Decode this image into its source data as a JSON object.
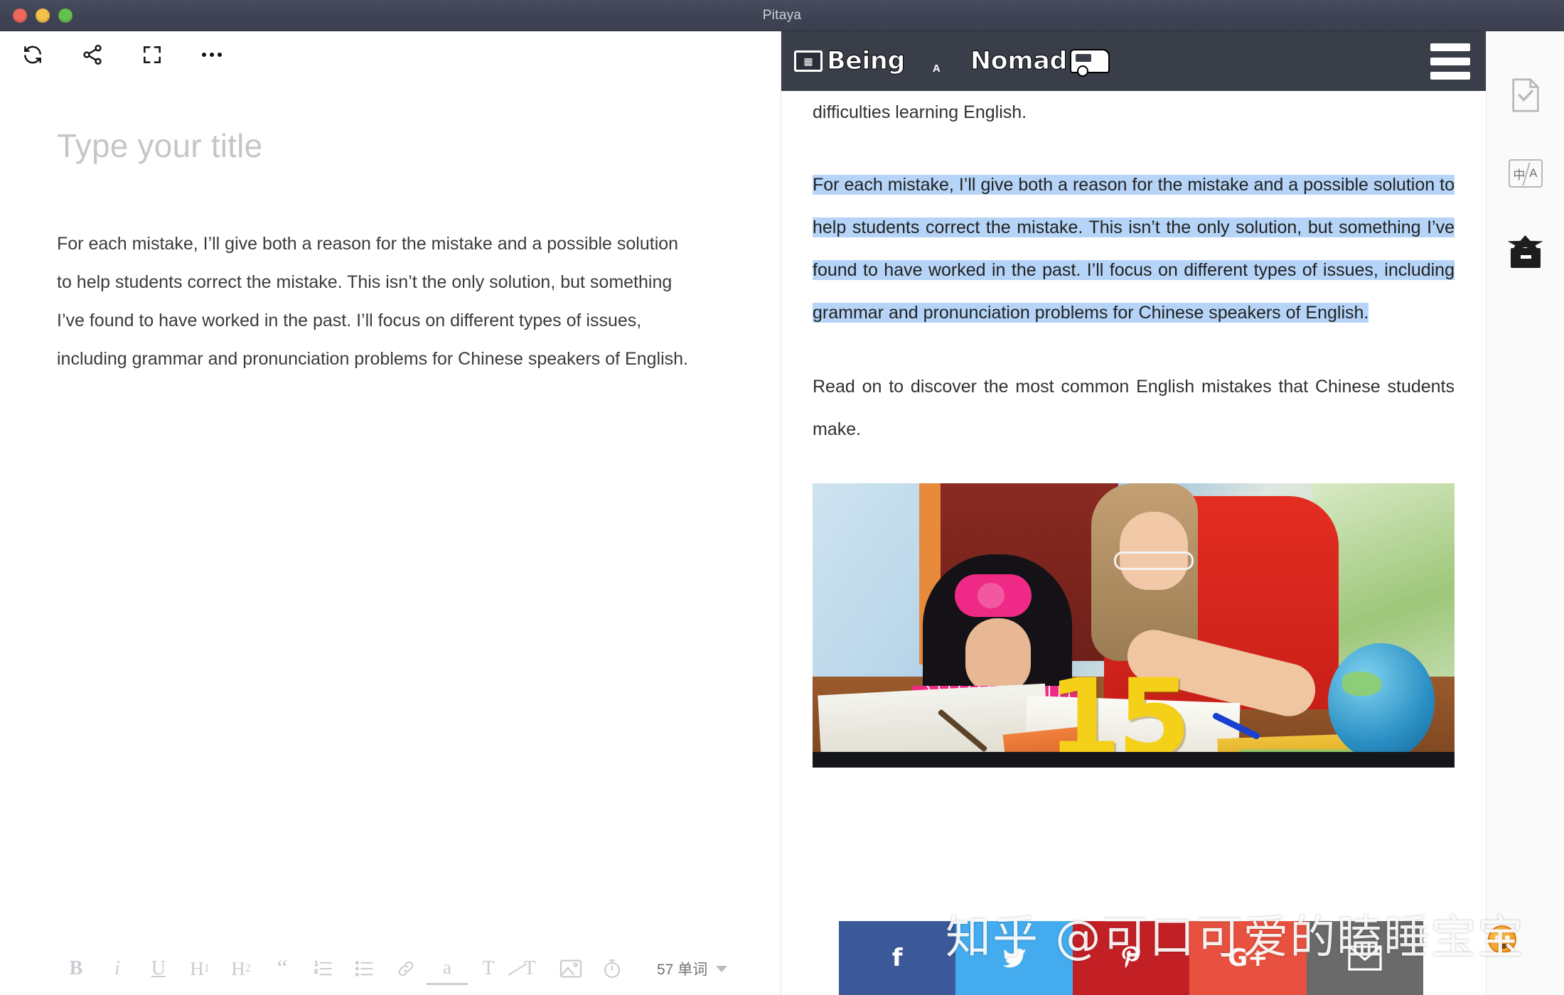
{
  "window": {
    "title": "Pitaya",
    "traffic_lights": [
      "close",
      "minimize",
      "zoom"
    ]
  },
  "editor": {
    "toolbar": [
      {
        "name": "refresh-icon",
        "label": "Sync"
      },
      {
        "name": "share-icon",
        "label": "Share"
      },
      {
        "name": "fullscreen-icon",
        "label": "Fullscreen"
      },
      {
        "name": "more-icon",
        "label": "More"
      }
    ],
    "title_placeholder": "Type your title",
    "title_value": "",
    "body_text": "For each mistake, I’ll give both a reason for the mistake and a possible solution to help students correct the mistake. This isn’t the only solution, but something I’ve found to have worked in the past. I’ll focus on different types of issues, including grammar and pronunciation problems for Chinese speakers of English.",
    "format_bar": {
      "bold": "B",
      "italic": "i",
      "underline": "U",
      "heading1": "H",
      "heading1_sub": "1",
      "heading2": "H",
      "heading2_sub": "2",
      "blockquote": "“",
      "ordered_list": "ordered-list-icon",
      "unordered_list": "unordered-list-icon",
      "link": "link-icon",
      "highlight": "a",
      "text_style": "T",
      "clear_format": "T",
      "image": "image-icon",
      "timer": "timer-icon",
      "word_count": "57 单词"
    }
  },
  "preview": {
    "site_banner": {
      "logo_text_1": "Being",
      "logo_letter": "A",
      "logo_text_2": "Nomad",
      "menu": "hamburger-menu-icon"
    },
    "paragraph_top": "...to Chinese students. But students can use it well to help them overcome their difficulties learning English.",
    "paragraph_selected": "For each mistake, I’ll give both a reason for the mistake and a possible solution to help students correct the mistake. This isn’t the only solution, but something I’ve found to have worked in the past. I’ll focus on different types of issues, including grammar and pronunciation problems for Chinese speakers of English.",
    "paragraph_after": "Read on to discover the most common English mistakes that Chinese students make.",
    "figure": {
      "alt": "Teacher helping a young girl with her homework at a desk with a globe",
      "overlay_number": "15"
    },
    "social_buttons": [
      {
        "name": "facebook-share-button",
        "label": "f",
        "color": "#3b5998"
      },
      {
        "name": "twitter-share-button",
        "label": "twitter-icon",
        "color": "#44acee"
      },
      {
        "name": "pinterest-share-button",
        "label": "pinterest-icon",
        "color": "#c32026"
      },
      {
        "name": "googleplus-share-button",
        "label": "G+",
        "color": "#e8513f"
      },
      {
        "name": "email-share-button",
        "label": "email-icon",
        "color": "#6a6a6a"
      }
    ],
    "selection_color": "#b5d4f7"
  },
  "sidebar": {
    "items": [
      {
        "name": "document-check-icon",
        "label": "Proofread"
      },
      {
        "name": "translate-icon",
        "label": "中/A"
      },
      {
        "name": "archive-star-icon",
        "label": "Collection"
      }
    ]
  },
  "watermark": {
    "text": "知乎 @可口可爱的瞌睡宝宝"
  }
}
